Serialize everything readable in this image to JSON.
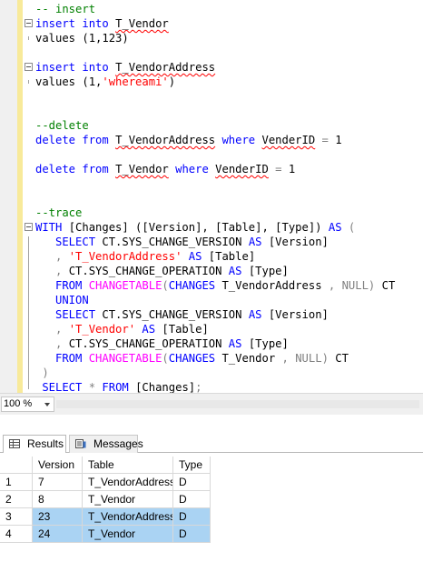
{
  "editor": {
    "lines": [
      [
        [
          "cm",
          "-- insert"
        ]
      ],
      [
        [
          "kw",
          "insert into "
        ],
        [
          "sq",
          "T_Vendor"
        ]
      ],
      [
        [
          "",
          "values (1,123)"
        ]
      ],
      [
        [
          "",
          ""
        ]
      ],
      [
        [
          "kw",
          "insert into "
        ],
        [
          "sq",
          "T_VendorAddress"
        ]
      ],
      [
        [
          "",
          "values (1,"
        ],
        [
          "st",
          "'whereami'"
        ],
        [
          "",
          ")"
        ]
      ],
      [
        [
          "",
          ""
        ]
      ],
      [
        [
          "",
          ""
        ]
      ],
      [
        [
          "cm",
          "--delete"
        ]
      ],
      [
        [
          "kw",
          "delete from "
        ],
        [
          "sq",
          "T_VendorAddress"
        ],
        [
          "kw",
          " where "
        ],
        [
          "sq",
          "VenderID"
        ],
        [
          "gr",
          " ="
        ],
        [
          "",
          " 1"
        ]
      ],
      [
        [
          "",
          ""
        ]
      ],
      [
        [
          "kw",
          "delete from "
        ],
        [
          "sq",
          "T_Vendor"
        ],
        [
          "kw",
          " where "
        ],
        [
          "sq",
          "VenderID"
        ],
        [
          "gr",
          " ="
        ],
        [
          "",
          " 1"
        ]
      ],
      [
        [
          "",
          ""
        ]
      ],
      [
        [
          "",
          ""
        ]
      ],
      [
        [
          "cm",
          "--trace"
        ]
      ],
      [
        [
          "kw",
          "WITH "
        ],
        [
          "",
          "[Changes] ([Version], [Table], [Type]) "
        ],
        [
          "kw",
          "AS "
        ],
        [
          "gr",
          "("
        ]
      ],
      [
        [
          "kw",
          "   SELECT "
        ],
        [
          "",
          "CT.SYS_CHANGE_VERSION "
        ],
        [
          "kw",
          "AS "
        ],
        [
          "",
          "[Version]"
        ]
      ],
      [
        [
          "gr",
          "   , "
        ],
        [
          "st",
          "'T_VendorAddress'"
        ],
        [
          "kw",
          " AS "
        ],
        [
          "",
          "[Table]"
        ]
      ],
      [
        [
          "gr",
          "   , "
        ],
        [
          "",
          "CT.SYS_CHANGE_OPERATION "
        ],
        [
          "kw",
          "AS "
        ],
        [
          "",
          "[Type]"
        ]
      ],
      [
        [
          "kw",
          "   FROM "
        ],
        [
          "fn",
          "CHANGETABLE"
        ],
        [
          "gr",
          "("
        ],
        [
          "kw",
          "CHANGES "
        ],
        [
          "",
          "T_VendorAddress "
        ],
        [
          "gr",
          ", "
        ],
        [
          "gr",
          "NULL"
        ],
        [
          "gr",
          ")"
        ],
        [
          "",
          " CT"
        ]
      ],
      [
        [
          "kw",
          "   UNION"
        ]
      ],
      [
        [
          "kw",
          "   SELECT "
        ],
        [
          "",
          "CT.SYS_CHANGE_VERSION "
        ],
        [
          "kw",
          "AS "
        ],
        [
          "",
          "[Version]"
        ]
      ],
      [
        [
          "gr",
          "   , "
        ],
        [
          "st",
          "'T_Vendor'"
        ],
        [
          "kw",
          " AS "
        ],
        [
          "",
          "[Table]"
        ]
      ],
      [
        [
          "gr",
          "   , "
        ],
        [
          "",
          "CT.SYS_CHANGE_OPERATION "
        ],
        [
          "kw",
          "AS "
        ],
        [
          "",
          "[Type]"
        ]
      ],
      [
        [
          "kw",
          "   FROM "
        ],
        [
          "fn",
          "CHANGETABLE"
        ],
        [
          "gr",
          "("
        ],
        [
          "kw",
          "CHANGES "
        ],
        [
          "",
          "T_Vendor "
        ],
        [
          "gr",
          ", "
        ],
        [
          "gr",
          "NULL"
        ],
        [
          "gr",
          ")"
        ],
        [
          "",
          " CT"
        ]
      ],
      [
        [
          "gr",
          " )"
        ]
      ],
      [
        [
          "kw",
          " SELECT "
        ],
        [
          "gr",
          "* "
        ],
        [
          "kw",
          "FROM "
        ],
        [
          "",
          "[Changes]"
        ],
        [
          "gr",
          ";"
        ]
      ]
    ]
  },
  "status": {
    "zoom": "100 %"
  },
  "tabs": {
    "results": "Results",
    "messages": "Messages"
  },
  "grid": {
    "columns": [
      "",
      "Version",
      "Table",
      "Type"
    ],
    "rows": [
      {
        "num": "1",
        "version": "7",
        "table": "T_VendorAddress",
        "type": "D",
        "selected": false
      },
      {
        "num": "2",
        "version": "8",
        "table": "T_Vendor",
        "type": "D",
        "selected": false
      },
      {
        "num": "3",
        "version": "23",
        "table": "T_VendorAddress",
        "type": "D",
        "selected": true
      },
      {
        "num": "4",
        "version": "24",
        "table": "T_Vendor",
        "type": "D",
        "selected": true
      }
    ]
  },
  "colors": {
    "selection": "#aad3f3",
    "keyword": "#0000ff",
    "comment": "#008000",
    "string": "#ff0000",
    "function": "#ff00ff"
  }
}
